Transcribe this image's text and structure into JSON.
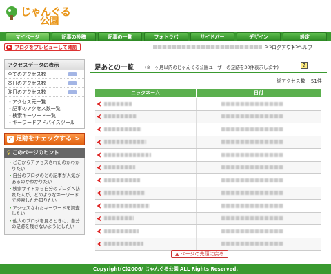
{
  "header": {
    "logo_line1": "じゃんぐる",
    "logo_line2": "公園"
  },
  "nav": [
    "マイページ",
    "記事の投稿",
    "記事の一覧",
    "フォトラバ",
    "サイドバー",
    "デザイン",
    "設定"
  ],
  "subbar": {
    "preview_label": "ブログをプレビューして確認",
    "logout": "ログアウト",
    "help": "ヘルプ",
    "sep": ">>"
  },
  "sidebar": {
    "access_title": "アクセスデータの表示",
    "stats": [
      {
        "label": "全てのアクセス数"
      },
      {
        "label": "本日のアクセス数"
      },
      {
        "label": "昨日のアクセス数"
      }
    ],
    "links": [
      "アクセス元一覧",
      "記事のアクセス数一覧",
      "検索キーワード一覧",
      "キーワードアドバイスツール"
    ],
    "check_label": "足跡をチェックする",
    "hint_title": "このページのヒント",
    "hints": [
      "どこからアクセスされたのかわかりたい",
      "自分のブログのどの記事が人気があるのかわかりたい",
      "検索サイトから自分のブログへ訪れた人が、どのようなキーワードで検索したか知りたい",
      "アクセスされたキーワードを調査したい",
      "他人のブログを見るときに、自分の足跡を残さないようにしたい"
    ]
  },
  "main": {
    "title": "足あとの一覧",
    "subtitle": "(※一ヶ月以内のじゃんぐる公園ユーザーの足跡を30件表示します)",
    "help_icon": "?",
    "total_label": "総アクセス数",
    "total_value": "51件",
    "columns": [
      "ニックネーム",
      "日付"
    ],
    "row_count": 12,
    "back_to_top": "ページの先頭に戻る"
  },
  "footer": {
    "copyright": "Copyright(C)2006/ じゃんぐる公園 ALL Rights Reserved."
  },
  "colors": {
    "brand_green": "#3a9a30",
    "accent_orange": "#e06010",
    "alert_red": "#d22"
  }
}
